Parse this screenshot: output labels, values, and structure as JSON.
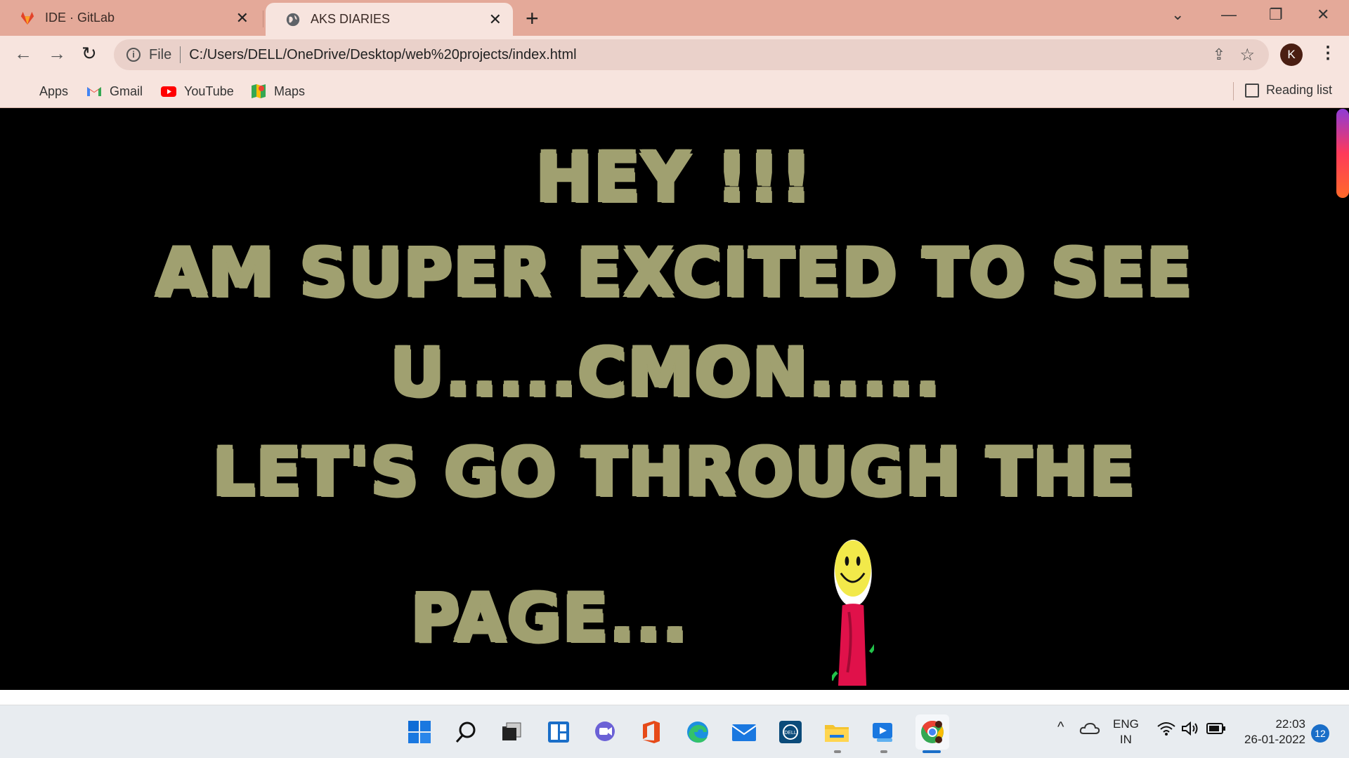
{
  "browser": {
    "tabs": [
      {
        "title": "IDE · GitLab",
        "icon": "gitlab-icon",
        "active": false
      },
      {
        "title": "AKS DIARIES",
        "icon": "globe-icon",
        "active": true
      }
    ],
    "new_tab": "+",
    "address": {
      "scheme": "File",
      "url": "C:/Users/DELL/OneDrive/Desktop/web%20projects/index.html"
    },
    "profile_initial": "K",
    "bookmarks": [
      {
        "label": "Apps",
        "icon": "apps-grid-icon"
      },
      {
        "label": "Gmail",
        "icon": "gmail-icon"
      },
      {
        "label": "YouTube",
        "icon": "youtube-icon"
      },
      {
        "label": "Maps",
        "icon": "maps-icon"
      }
    ],
    "reading_list": "Reading list"
  },
  "page": {
    "lines": [
      "HEY !!!",
      "AM SUPER EXCITED TO SEE",
      "U.....CMON.....",
      "LET'S GO THROUGH THE",
      "PAGE..."
    ],
    "text_color": "#a0a070",
    "background": "#000000"
  },
  "taskbar": {
    "apps": [
      "windows-start-icon",
      "search-icon",
      "task-view-icon",
      "widgets-icon",
      "teams-chat-icon",
      "office-icon",
      "edge-icon",
      "mail-icon",
      "dell-icon",
      "file-explorer-icon",
      "media-player-icon",
      "chrome-icon"
    ],
    "language": {
      "line1": "ENG",
      "line2": "IN"
    },
    "time": "22:03",
    "date": "26-01-2022",
    "notifications": "12"
  }
}
